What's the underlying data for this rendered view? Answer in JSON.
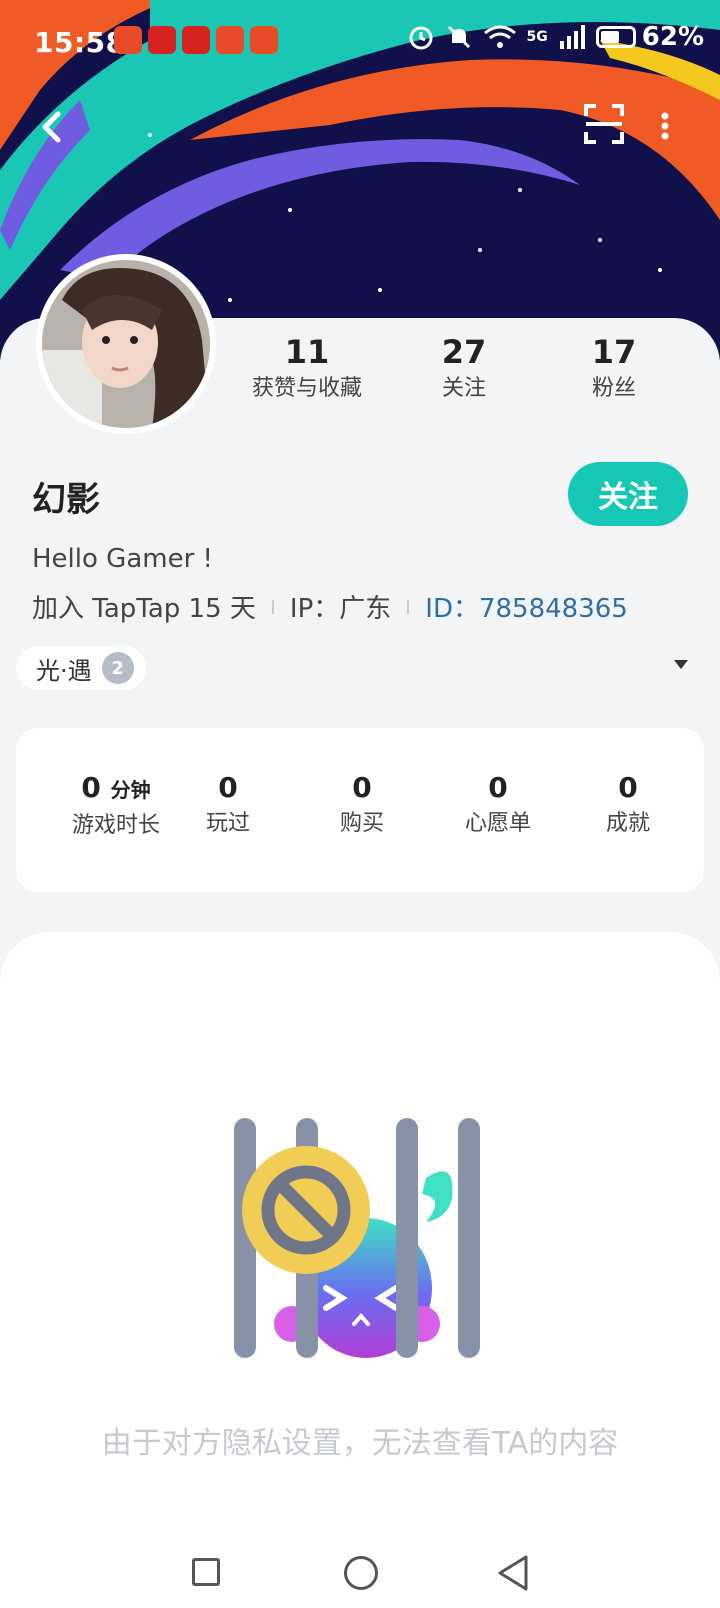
{
  "status_bar": {
    "time": "15:58",
    "battery": "62%",
    "network": "5G"
  },
  "profile": {
    "name": "幻影",
    "follow_label": "关注",
    "bio": "Hello Gamer !",
    "joined": "加入 TapTap 15 天",
    "ip": "IP：广东",
    "id": "ID：785848365",
    "stats": [
      {
        "value": "11",
        "label": "获赞与收藏"
      },
      {
        "value": "27",
        "label": "关注"
      },
      {
        "value": "17",
        "label": "粉丝"
      }
    ],
    "game_tag": {
      "name": "光·遇",
      "badge": "2"
    }
  },
  "game_stats": [
    {
      "value": "0",
      "unit": "分钟",
      "label": "游戏时长"
    },
    {
      "value": "0",
      "unit": "",
      "label": "玩过"
    },
    {
      "value": "0",
      "unit": "",
      "label": "购买"
    },
    {
      "value": "0",
      "unit": "",
      "label": "心愿单"
    },
    {
      "value": "0",
      "unit": "",
      "label": "成就"
    }
  ],
  "privacy_message": "由于对方隐私设置，无法查看TA的内容",
  "colors": {
    "accent": "#17c7b6",
    "header_bg": "#10104a",
    "id_link": "#2e6fa6"
  }
}
